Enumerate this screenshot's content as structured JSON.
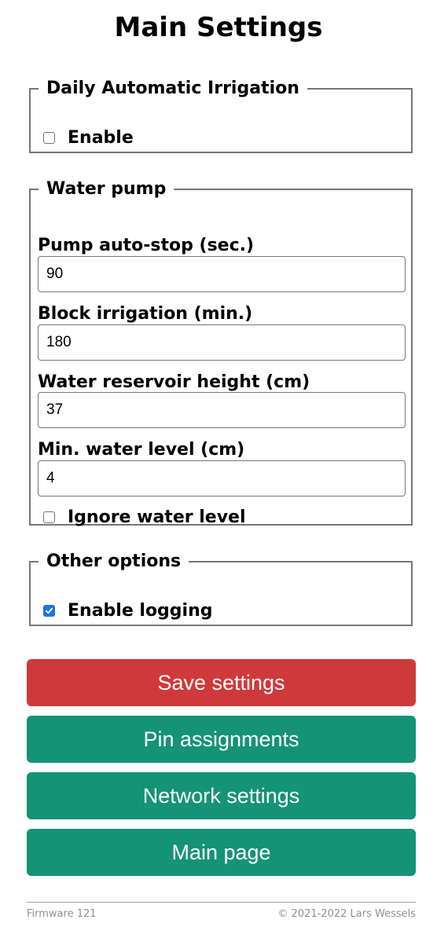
{
  "page": {
    "title": "Main Settings"
  },
  "irrigation": {
    "legend": "Daily Automatic Irrigation",
    "enable_label": "Enable",
    "enable_checked": false
  },
  "pump": {
    "legend": "Water pump",
    "fields": [
      {
        "label": "Pump auto-stop (sec.)",
        "value": "90"
      },
      {
        "label": "Block irrigation (min.)",
        "value": "180"
      },
      {
        "label": "Water reservoir height (cm)",
        "value": "37"
      },
      {
        "label": "Min. water level (cm)",
        "value": "4"
      }
    ],
    "ignore_label": "Ignore water level",
    "ignore_checked": false
  },
  "other": {
    "legend": "Other options",
    "logging_label": "Enable logging",
    "logging_checked": true
  },
  "buttons": {
    "save": "Save settings",
    "pins": "Pin assignments",
    "network": "Network settings",
    "main": "Main page"
  },
  "colors": {
    "save": "#d0393c",
    "nav": "#159377",
    "checkbox_checked": "#1a73e8"
  },
  "footer": {
    "firmware": "Firmware 121",
    "copyright": "© 2021-2022 Lars Wessels"
  }
}
